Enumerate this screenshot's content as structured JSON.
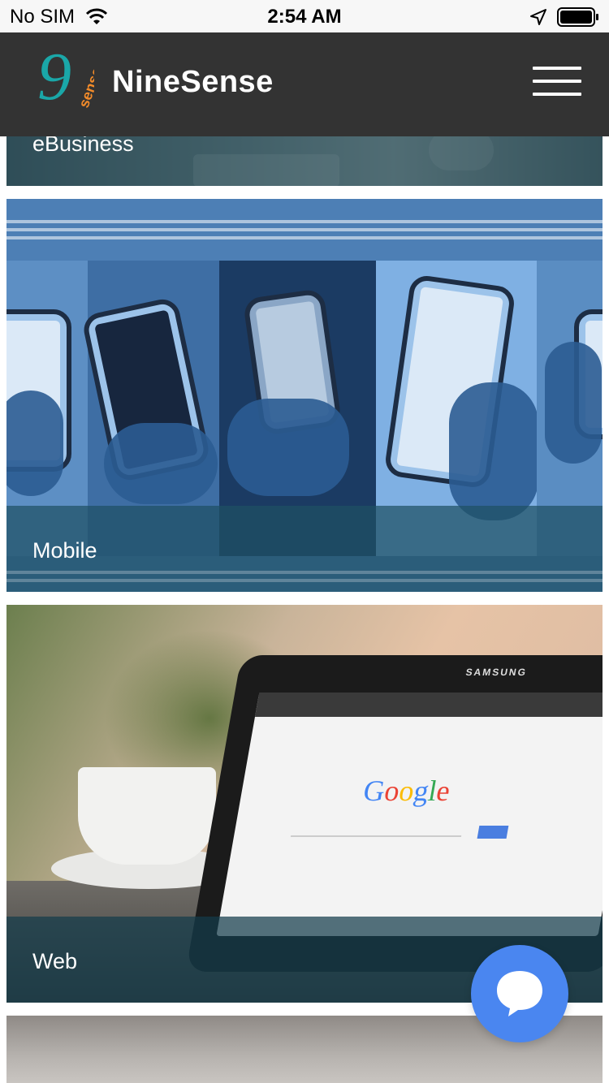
{
  "status_bar": {
    "carrier": "No SIM",
    "time": "2:54 AM",
    "icons": [
      "wifi-icon",
      "location-arrow-icon",
      "battery-icon"
    ]
  },
  "header": {
    "brand": "NineSense",
    "logo_icon": "ninesense-logo",
    "menu_icon": "hamburger-menu-icon"
  },
  "cards": [
    {
      "label": "eBusiness"
    },
    {
      "label": "Mobile"
    },
    {
      "label": "Web"
    }
  ],
  "tablet_screen": {
    "device_brand": "SAMSUNG",
    "search_logo": [
      "G",
      "o",
      "o",
      "g",
      "l",
      "e"
    ]
  },
  "chat_fab": {
    "icon": "chat-bubble-icon"
  },
  "colors": {
    "header_bg": "#333333",
    "fab_bg": "#4a86f0",
    "status_bg": "#f7f7f7"
  }
}
